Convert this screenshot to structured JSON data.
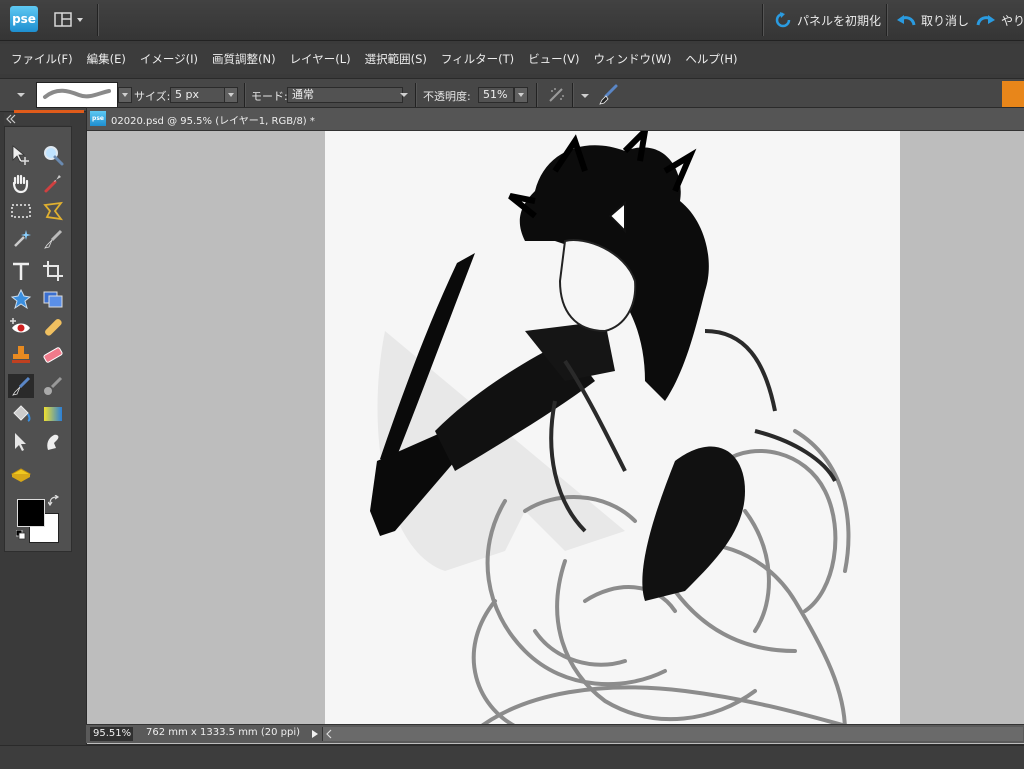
{
  "app": {
    "logo_text": "pse",
    "accent_color": "#2a9be0"
  },
  "titlebar": {
    "reset_panels_label": "パネルを初期化",
    "undo_label": "取り消し",
    "redo_label": "やり直"
  },
  "menu": [
    "ファイル(F)",
    "編集(E)",
    "イメージ(I)",
    "画質調整(N)",
    "レイヤー(L)",
    "選択範囲(S)",
    "フィルター(T)",
    "ビュー(V)",
    "ウィンドウ(W)",
    "ヘルプ(H)"
  ],
  "options": {
    "size_label": "サイズ:",
    "size_value": "5 px",
    "mode_label": "モード:",
    "mode_value": "通常",
    "opacity_label": "不透明度:",
    "opacity_value": "51%"
  },
  "document": {
    "title": "02020.psd @ 95.5% (レイヤー1, RGB/8) *",
    "zoom": "95.51%",
    "dimensions": "762 mm x 1333.5 mm (20 ppi)"
  },
  "colors": {
    "foreground": "#000000",
    "background": "#ffffff"
  },
  "tools": [
    "move-tool",
    "zoom-tool",
    "hand-tool",
    "eyedropper-tool",
    "marquee-tool",
    "lasso-tool",
    "magic-wand-tool",
    "selection-brush-tool",
    "type-tool",
    "crop-tool",
    "cookie-cutter-tool",
    "recompose-tool",
    "red-eye-tool",
    "healing-brush-tool",
    "clone-stamp-tool",
    "eraser-tool",
    "brush-tool",
    "smart-brush-tool",
    "paint-bucket-tool",
    "gradient-tool",
    "shape-select-tool",
    "blur-tool",
    "sponge-tool"
  ]
}
